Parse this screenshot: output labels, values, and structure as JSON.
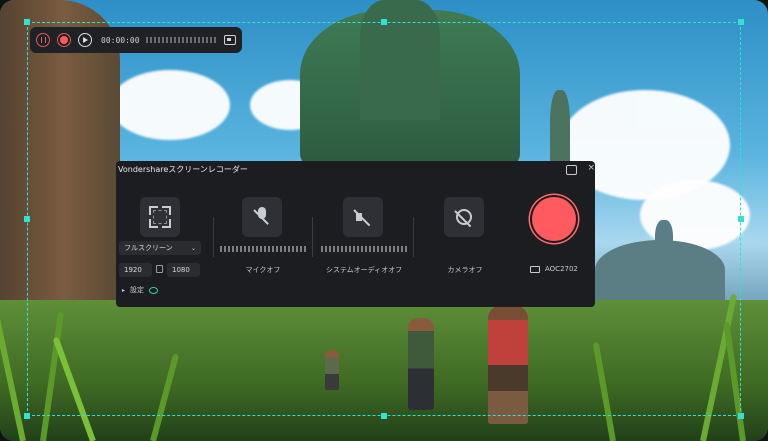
{
  "mini_toolbar": {
    "timer": "00:00:00",
    "icons": [
      "pause-icon",
      "record-icon",
      "play-icon",
      "screenshot-icon"
    ]
  },
  "panel": {
    "title": "Vondershareスクリーンレコーダー",
    "capture": {
      "mode": "フルスクリーン",
      "width": "1920",
      "height": "1080"
    },
    "mic_label": "マイクオフ",
    "system_audio_label": "システムオーディオオフ",
    "camera_label": "カメラオフ",
    "monitor_label": "AOC2702",
    "settings_label": "設定"
  },
  "colors": {
    "accent_record": "#ff5a5f",
    "selection_border": "#35e0d0",
    "panel_bg": "#1c1d20"
  }
}
